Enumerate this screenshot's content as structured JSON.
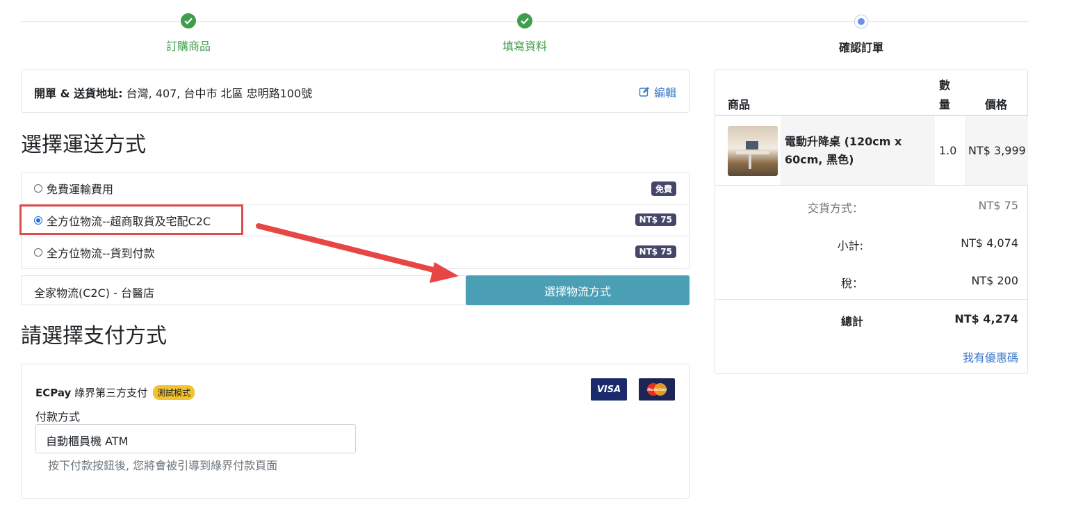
{
  "steps": [
    {
      "label": "訂購商品",
      "state": "done"
    },
    {
      "label": "填寫資料",
      "state": "done"
    },
    {
      "label": "確認訂單",
      "state": "current"
    }
  ],
  "address": {
    "label": "開單 & 送貨地址:",
    "value": "台灣, 407, 台中市 北區 忠明路100號",
    "edit_label": "編輯"
  },
  "shipping": {
    "heading": "選擇運送方式",
    "options": [
      {
        "label": "免費運輸費用",
        "badge": "免費",
        "selected": false
      },
      {
        "label": "全方位物流--超商取貨及宅配C2C",
        "badge": "NT$ 75",
        "selected": true
      },
      {
        "label": "全方位物流--貨到付款",
        "badge": "NT$ 75",
        "selected": false
      }
    ],
    "logistics_store": "全家物流(C2C) - 台醫店",
    "logistics_button": "選擇物流方式"
  },
  "payment": {
    "heading": "請選擇支付方式",
    "provider_brand": "ECPay",
    "provider_name": "綠界第三方支付",
    "test_badge": "測試模式",
    "cards": [
      "VISA",
      "MasterCard"
    ],
    "method_label": "付款方式",
    "method_value": "自動櫃員機 ATM",
    "hint": "按下付款按鈕後, 您將會被引導到綠界付款頁面"
  },
  "summary": {
    "headers": {
      "product": "商品",
      "qty": "數量",
      "price": "價格"
    },
    "item": {
      "name": "電動升降桌 (120cm x 60cm, 黑色)",
      "qty": "1.0",
      "price": "NT$ 3,999"
    },
    "delivery_label": "交貨方式：",
    "delivery_value": "NT$ 75",
    "subtotal_label": "小計:",
    "subtotal_value": "NT$ 4,074",
    "tax_label": "稅：",
    "tax_value": "NT$ 200",
    "total_label": "總計",
    "total_value": "NT$ 4,274",
    "coupon_link": "我有優惠碼"
  },
  "colors": {
    "success": "#3f9e4d",
    "link": "#3d78c9",
    "badge": "#45476a",
    "button": "#4a9fb5",
    "highlight": "#e04b4b"
  }
}
